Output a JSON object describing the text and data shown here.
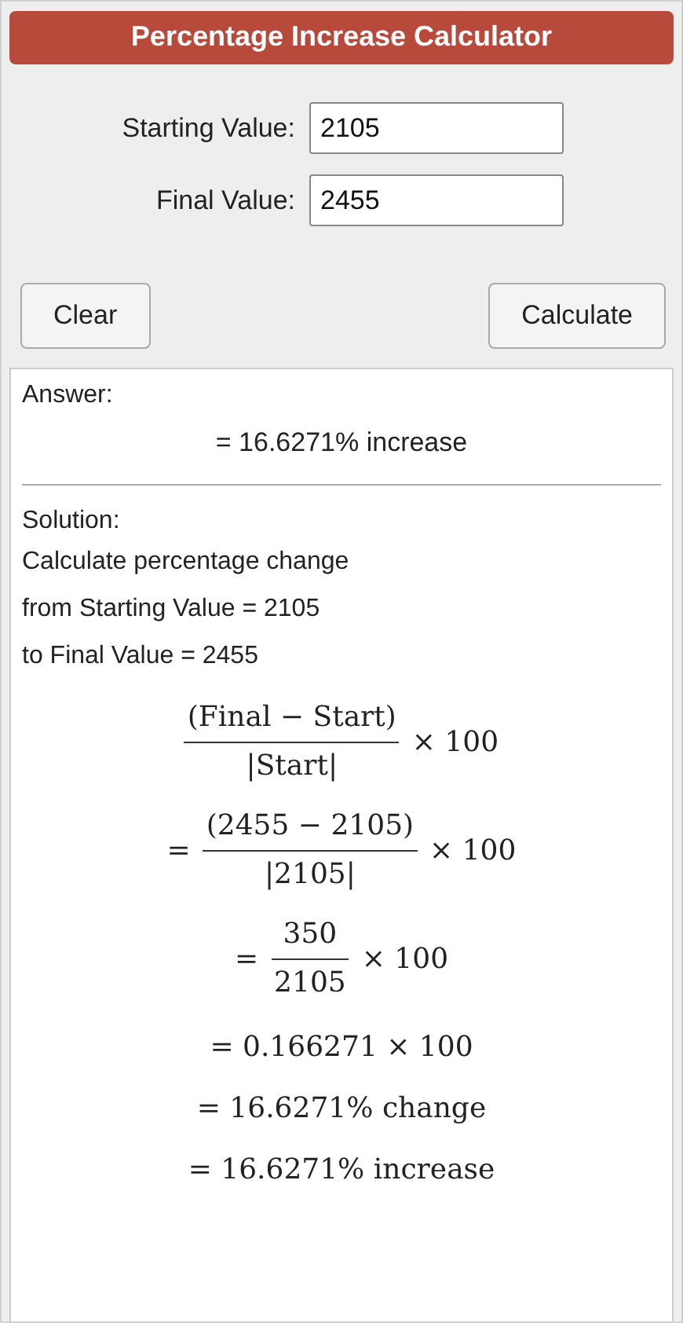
{
  "title": "Percentage Increase Calculator",
  "fields": [
    {
      "label": "Starting Value:",
      "value": "2105"
    },
    {
      "label": "Final Value:",
      "value": "2455"
    }
  ],
  "buttons": [
    {
      "label": "Clear"
    },
    {
      "label": "Calculate"
    }
  ],
  "answer": {
    "label": "Answer:",
    "result": "= 16.6271% increase"
  },
  "solution": {
    "label": "Solution:",
    "lines": [
      "Calculate percentage change",
      "from Starting Value = 2105",
      "to Final Value = 2455"
    ],
    "steps": [
      {
        "kind": "fraction",
        "numerator": "(Final − Start)",
        "denominator": "|Start|",
        "trail": "× 100"
      },
      {
        "kind": "fraction",
        "lead": "=",
        "numerator": "(2455 − 2105)",
        "denominator": "|2105|",
        "trail": "× 100"
      },
      {
        "kind": "fraction",
        "lead": "=",
        "numerator": "350",
        "denominator": "2105",
        "trail": "× 100"
      },
      {
        "kind": "plain",
        "text": "= 0.166271 × 100"
      },
      {
        "kind": "plain",
        "text": "= 16.6271% change"
      },
      {
        "kind": "plain",
        "text": "= 16.6271% increase"
      }
    ]
  }
}
